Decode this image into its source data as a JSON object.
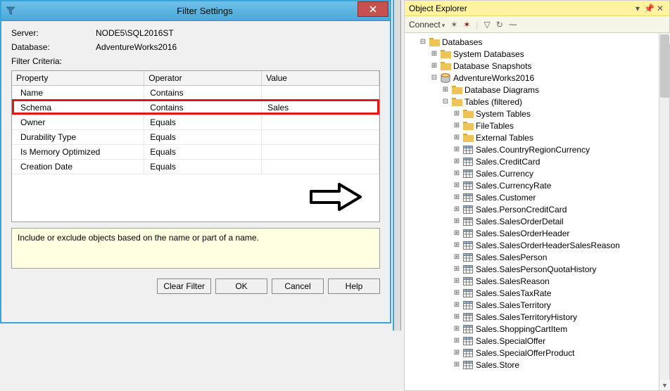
{
  "dialog": {
    "title": "Filter Settings",
    "server_label": "Server:",
    "server_value": "NODE5\\SQL2016ST",
    "database_label": "Database:",
    "database_value": "AdventureWorks2016",
    "criteria_label": "Filter Criteria:",
    "columns": {
      "property": "Property",
      "operator": "Operator",
      "value": "Value"
    },
    "rows": [
      {
        "property": "Name",
        "operator": "Contains",
        "value": ""
      },
      {
        "property": "Schema",
        "operator": "Contains",
        "value": "Sales"
      },
      {
        "property": "Owner",
        "operator": "Equals",
        "value": ""
      },
      {
        "property": "Durability Type",
        "operator": "Equals",
        "value": ""
      },
      {
        "property": "Is Memory Optimized",
        "operator": "Equals",
        "value": ""
      },
      {
        "property": "Creation Date",
        "operator": "Equals",
        "value": ""
      }
    ],
    "hint": "Include or exclude objects based on the name or part of a name.",
    "buttons": {
      "clear": "Clear Filter",
      "ok": "OK",
      "cancel": "Cancel",
      "help": "Help"
    }
  },
  "explorer": {
    "title": "Object Explorer",
    "connect": "Connect",
    "tree": {
      "root": "Databases",
      "children": [
        {
          "label": "System Databases",
          "type": "folder",
          "exp": "+"
        },
        {
          "label": "Database Snapshots",
          "type": "folder",
          "exp": "+"
        },
        {
          "label": "AdventureWorks2016",
          "type": "db",
          "exp": "-",
          "children": [
            {
              "label": "Database Diagrams",
              "type": "folder",
              "exp": "+"
            },
            {
              "label": "Tables (filtered)",
              "type": "folder",
              "exp": "-",
              "children": [
                {
                  "label": "System Tables",
                  "type": "folder",
                  "exp": "+"
                },
                {
                  "label": "FileTables",
                  "type": "folder",
                  "exp": "+"
                },
                {
                  "label": "External Tables",
                  "type": "folder",
                  "exp": "+"
                },
                {
                  "label": "Sales.CountryRegionCurrency",
                  "type": "table",
                  "exp": "+"
                },
                {
                  "label": "Sales.CreditCard",
                  "type": "table",
                  "exp": "+"
                },
                {
                  "label": "Sales.Currency",
                  "type": "table",
                  "exp": "+"
                },
                {
                  "label": "Sales.CurrencyRate",
                  "type": "table",
                  "exp": "+"
                },
                {
                  "label": "Sales.Customer",
                  "type": "table",
                  "exp": "+"
                },
                {
                  "label": "Sales.PersonCreditCard",
                  "type": "table",
                  "exp": "+"
                },
                {
                  "label": "Sales.SalesOrderDetail",
                  "type": "table",
                  "exp": "+"
                },
                {
                  "label": "Sales.SalesOrderHeader",
                  "type": "table",
                  "exp": "+"
                },
                {
                  "label": "Sales.SalesOrderHeaderSalesReason",
                  "type": "table",
                  "exp": "+"
                },
                {
                  "label": "Sales.SalesPerson",
                  "type": "table",
                  "exp": "+"
                },
                {
                  "label": "Sales.SalesPersonQuotaHistory",
                  "type": "table",
                  "exp": "+"
                },
                {
                  "label": "Sales.SalesReason",
                  "type": "table",
                  "exp": "+"
                },
                {
                  "label": "Sales.SalesTaxRate",
                  "type": "table",
                  "exp": "+"
                },
                {
                  "label": "Sales.SalesTerritory",
                  "type": "table",
                  "exp": "+"
                },
                {
                  "label": "Sales.SalesTerritoryHistory",
                  "type": "table",
                  "exp": "+"
                },
                {
                  "label": "Sales.ShoppingCartItem",
                  "type": "table",
                  "exp": "+"
                },
                {
                  "label": "Sales.SpecialOffer",
                  "type": "table",
                  "exp": "+"
                },
                {
                  "label": "Sales.SpecialOfferProduct",
                  "type": "table",
                  "exp": "+"
                },
                {
                  "label": "Sales.Store",
                  "type": "table",
                  "exp": "+"
                }
              ]
            }
          ]
        }
      ]
    }
  }
}
